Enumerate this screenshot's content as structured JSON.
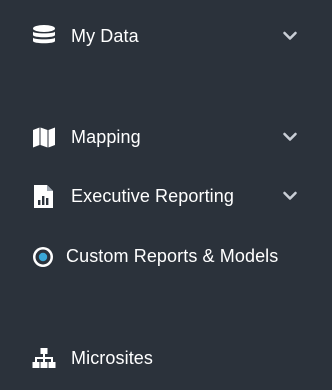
{
  "nav": {
    "items": [
      {
        "label": "My Data",
        "icon": "database-icon",
        "expandable": true
      },
      {
        "label": "Mapping",
        "icon": "map-icon",
        "expandable": true
      },
      {
        "label": "Executive Reporting",
        "icon": "report-chart-icon",
        "expandable": true
      },
      {
        "label": "Custom Reports & Models",
        "icon": "radio-target-icon",
        "expandable": false
      },
      {
        "label": "Microsites",
        "icon": "sitemap-icon",
        "expandable": false
      }
    ]
  },
  "colors": {
    "background": "#2b323b",
    "text": "#ffffff",
    "chevron": "#c9ced6",
    "accent": "#3aa7d6"
  }
}
